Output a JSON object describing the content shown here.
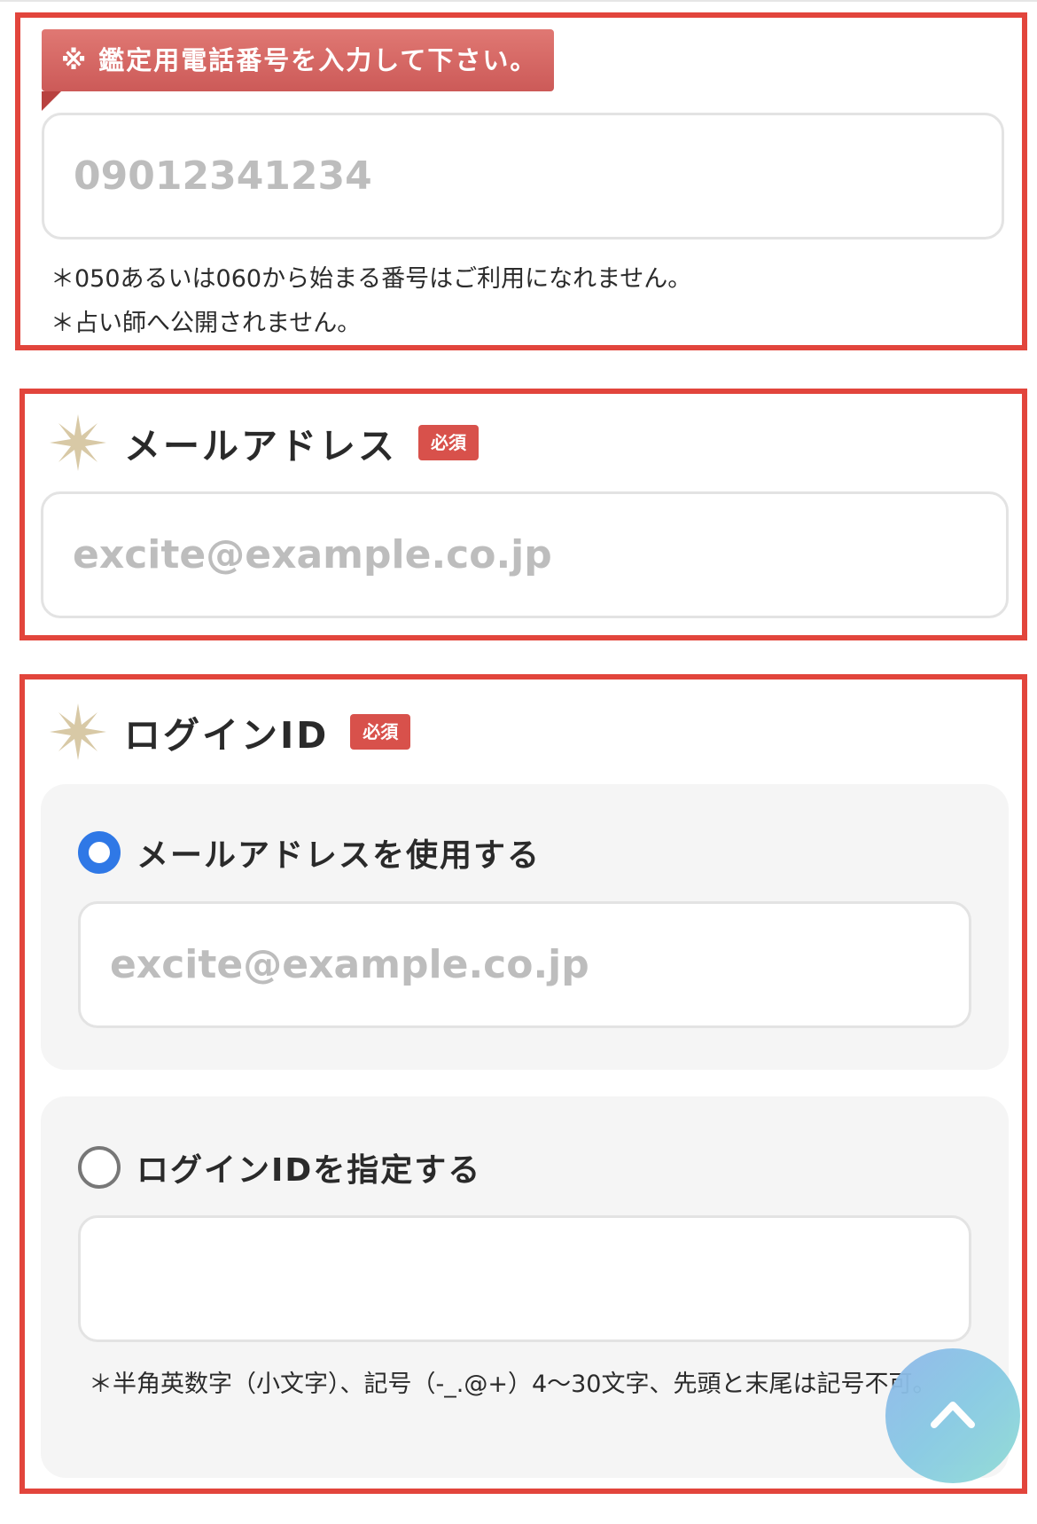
{
  "phone_section": {
    "banner": "※ 鑑定用電話番号を入力して下さい。",
    "input_placeholder": "09012341234",
    "notes": [
      "＊050あるいは060から始まる番号はご利用になれません。",
      "＊占い師へ公開されません。"
    ]
  },
  "email_section": {
    "label": "メールアドレス",
    "required_badge": "必須",
    "input_placeholder": "excite@example.co.jp"
  },
  "login_section": {
    "label": "ログインID",
    "required_badge": "必須",
    "options": [
      {
        "label": "メールアドレスを使用する",
        "selected": true,
        "input_placeholder": "excite@example.co.jp"
      },
      {
        "label": "ログインIDを指定する",
        "selected": false,
        "input_value": "",
        "note": "＊半角英数字（小文字）、記号（-_.@+）4〜30文字、先頭と末尾は記号不可。"
      }
    ]
  },
  "icons": {
    "heading_marker": "sparkle-icon",
    "scroll_top": "chevron-up-icon"
  },
  "colors": {
    "section_border": "#e2453c",
    "banner": "#d8625f",
    "badge": "#d8514b",
    "radio_selected": "#2f78e6",
    "sparkle": "#d8c9a6"
  }
}
